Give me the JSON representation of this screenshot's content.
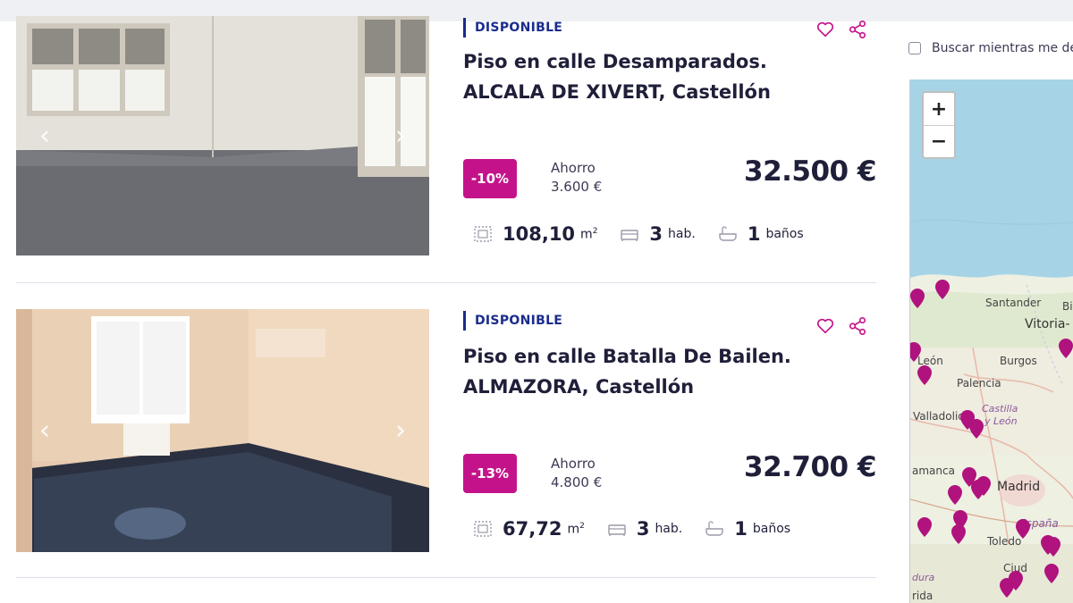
{
  "listings": [
    {
      "status": "DISPONIBLE",
      "title_line1": "Piso en calle Desamparados.",
      "title_line2": "ALCALA DE XIVERT, Castellón",
      "discount": "-10%",
      "saving_label": "Ahorro",
      "saving_value": "3.600 €",
      "price": "32.500 €",
      "area": "108,10",
      "area_unit": "m",
      "rooms": "3",
      "rooms_unit": "hab.",
      "baths": "1",
      "baths_unit": "baños"
    },
    {
      "status": "DISPONIBLE",
      "title_line1": "Piso en calle Batalla De Bailen.",
      "title_line2": "ALMAZORA, Castellón",
      "discount": "-13%",
      "saving_label": "Ahorro",
      "saving_value": "4.800 €",
      "price": "32.700 €",
      "area": "67,72",
      "area_unit": "m",
      "rooms": "3",
      "rooms_unit": "hab.",
      "baths": "1",
      "baths_unit": "baños"
    }
  ],
  "map": {
    "search_checkbox_label": "Buscar mientras me de",
    "search_checked": false,
    "zoom_in": "+",
    "zoom_out": "−",
    "labels": {
      "santander": "Santander",
      "vitoria": "Vitoria-",
      "bi": "Bi",
      "leon": "León",
      "burgos": "Burgos",
      "palencia": "Palencia",
      "valladolid": "Valladolid",
      "castilla": "Castilla",
      "yleon": "y León",
      "salamanca": "amanca",
      "madrid": "Madrid",
      "espana": "España",
      "toledo": "Toledo",
      "ciudad": "Ciud",
      "dura": "dura",
      "rida": "rida"
    }
  },
  "colors": {
    "accent": "#c4138a",
    "status": "#1a2c8c",
    "pin": "#b0127e",
    "sea": "#a6d4e6",
    "land": "#f2efe6"
  },
  "icons": [
    "heart-icon",
    "share-icon",
    "area-icon",
    "bed-icon",
    "bath-icon",
    "chevron-left-icon",
    "chevron-right-icon",
    "map-pin-icon"
  ]
}
